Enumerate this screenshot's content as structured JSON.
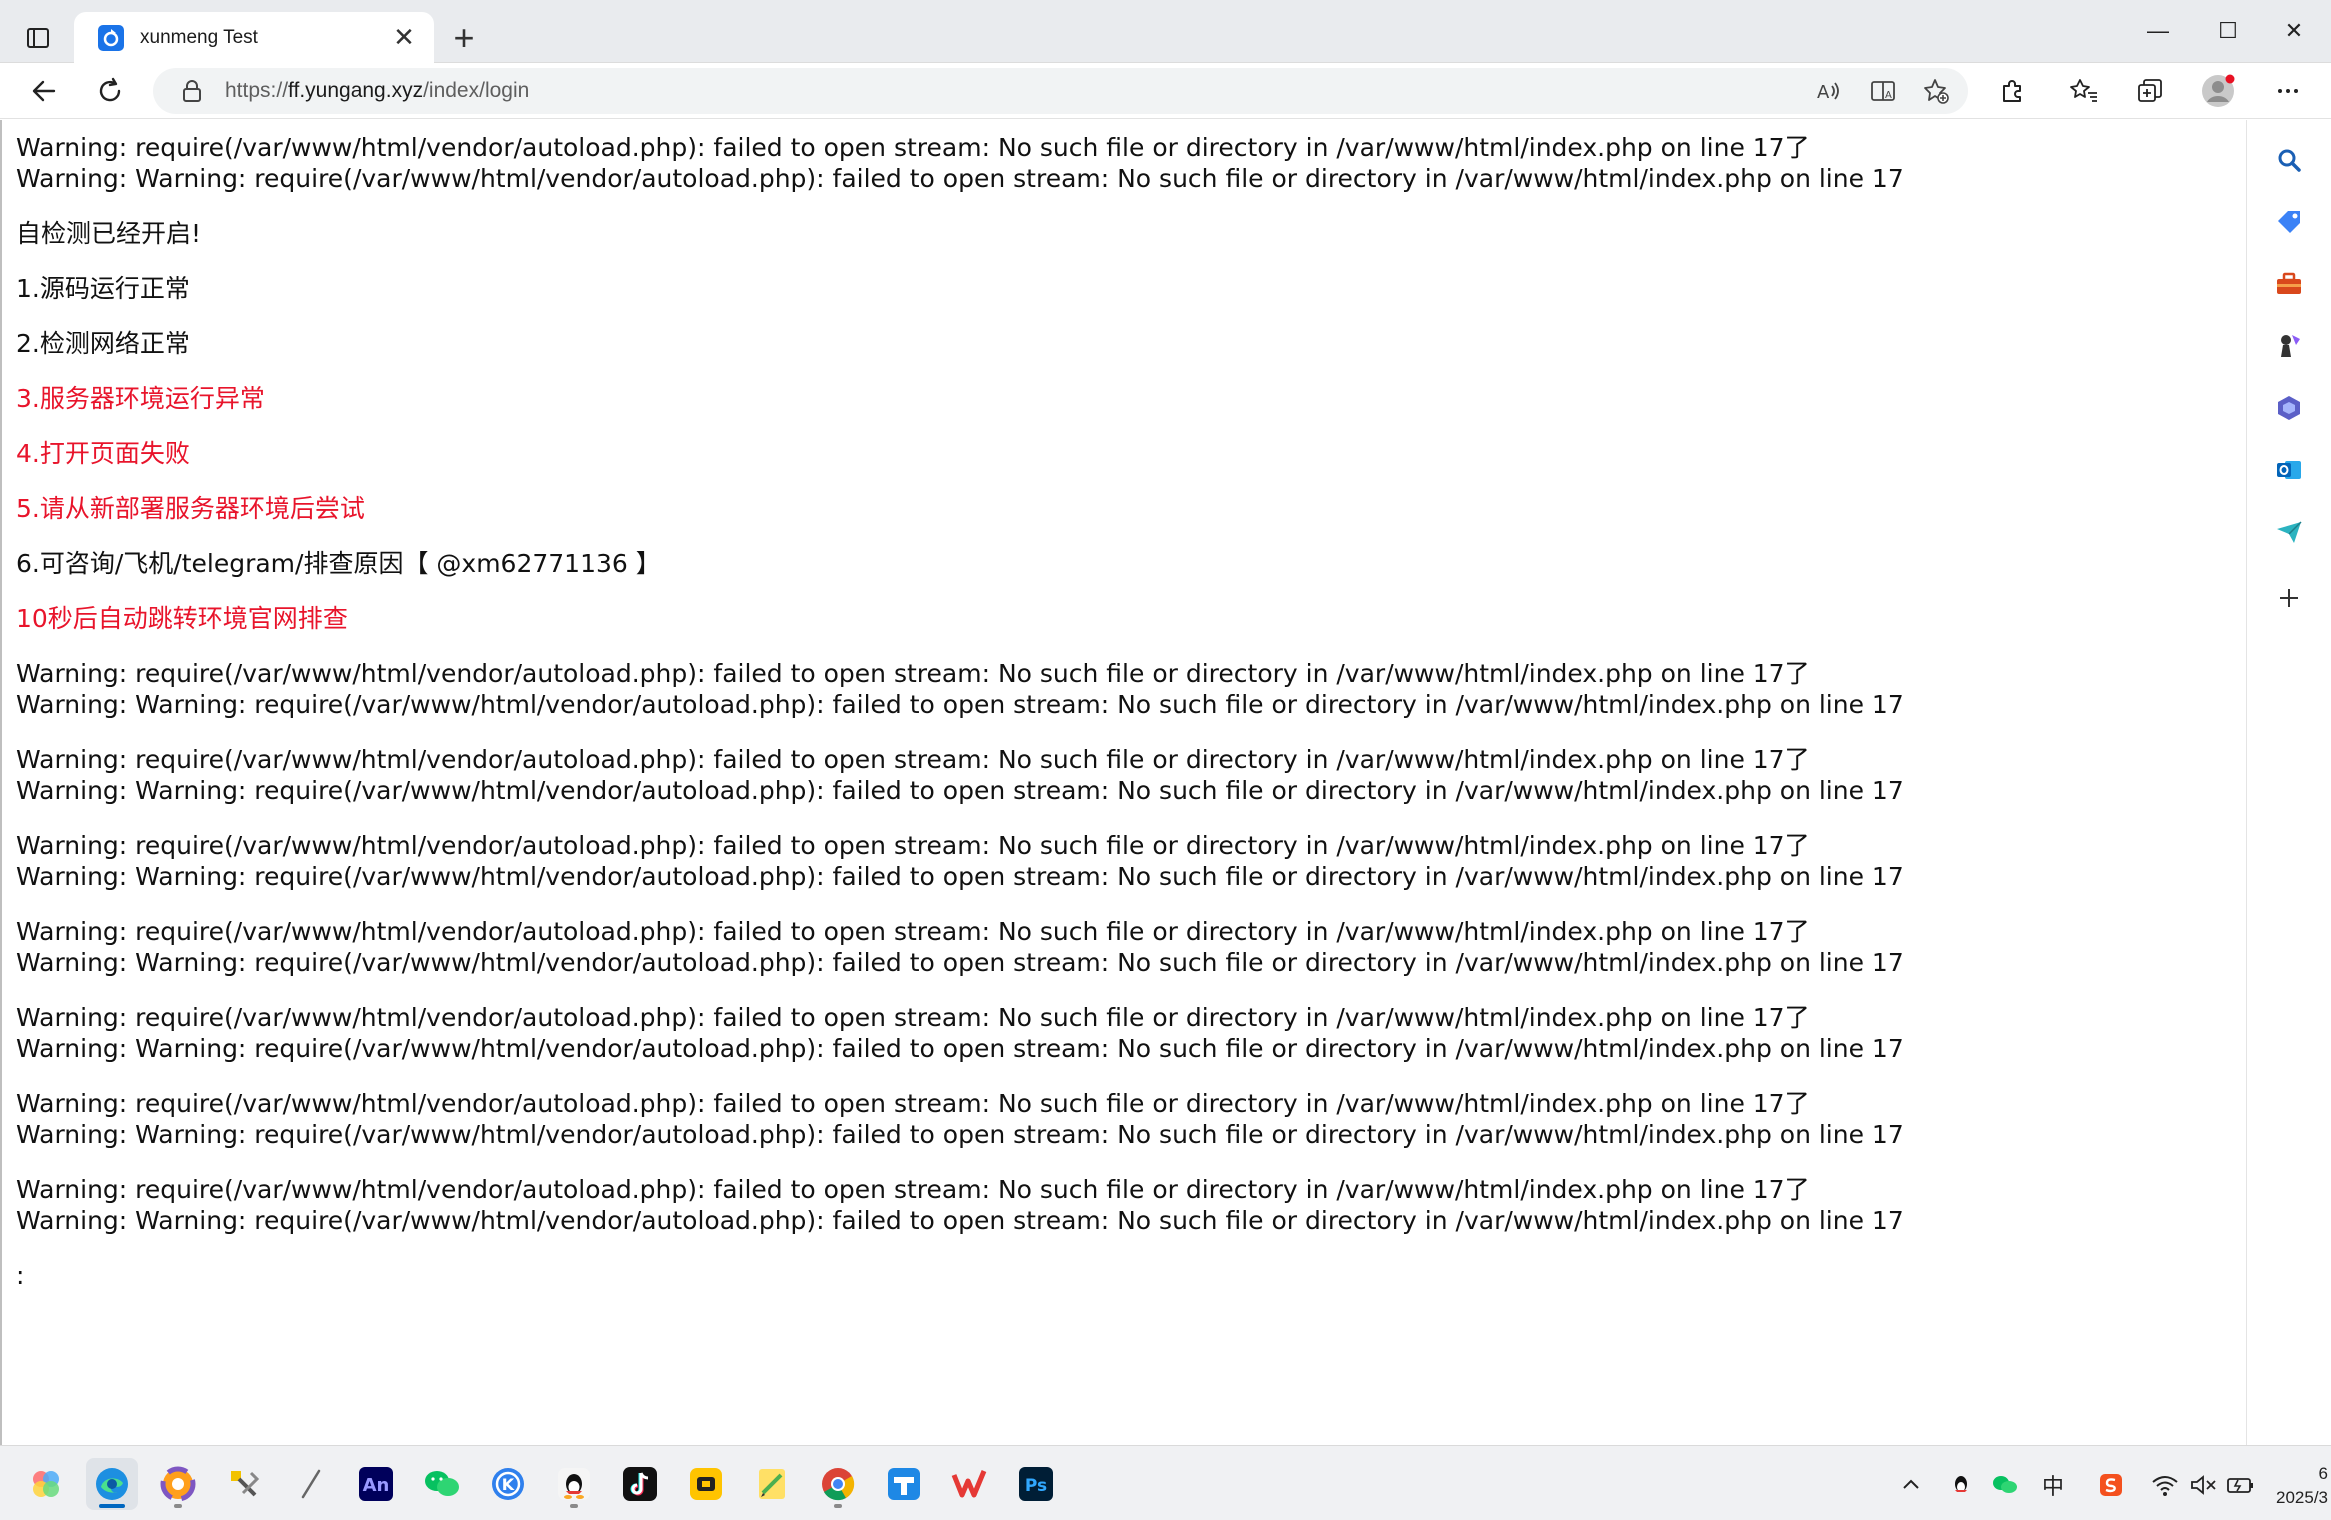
{
  "browser": {
    "tab": {
      "title": "xunmeng Test",
      "close_glyph": "✕"
    },
    "new_tab_glyph": "+",
    "window": {
      "minimize": "—",
      "maximize": "☐",
      "close": "✕"
    },
    "address": {
      "scheme_prefix": "https://",
      "host": "ff.yungang.xyz",
      "path": "/index/login"
    }
  },
  "page": {
    "warning_text": "Warning: require(/var/www/html/vendor/autoload.php): failed to open stream: No such file or directory in /var/www/html/index.php on line 17了Warning: Warning: require(/var/www/html/vendor/autoload.php): failed to open stream: No such file or directory in /var/www/html/index.php on line 17",
    "lines": [
      {
        "text": "自检测已经开启!",
        "color": "#111111"
      },
      {
        "text": "1.源码运行正常",
        "color": "#111111"
      },
      {
        "text": "2.检测网络正常",
        "color": "#111111"
      },
      {
        "text": "3.服务器环境运行异常",
        "color": "#e8142b"
      },
      {
        "text": "4.打开页面失败",
        "color": "#e8142b"
      },
      {
        "text": "5.请从新部署服务器环境后尝试",
        "color": "#e8142b"
      },
      {
        "text": "6.可咨询/飞机/telegram/排查原因【 @xm62771136 】",
        "color": "#111111"
      },
      {
        "text": "10秒后自动跳转环境官网排查",
        "color": "#e8142b"
      }
    ],
    "trailing": ":"
  },
  "sidebar_icons": [
    "search-icon",
    "tag-icon",
    "toolbox-icon",
    "chess-icon",
    "copilot-icon",
    "outlook-icon",
    "send-icon",
    "add-icon"
  ],
  "taskbar": {
    "apps": [
      "start-icon",
      "edge-icon",
      "browser360-icon",
      "tools-icon",
      "pen-icon",
      "animate-icon",
      "wechat-icon",
      "kuaiche-icon",
      "qq-icon",
      "tiktok-icon",
      "yellow-app-icon",
      "notes-icon",
      "chrome-icon",
      "blue-app-icon",
      "wps-icon",
      "photoshop-icon"
    ],
    "animate_label": "An",
    "photoshop_label": "Ps",
    "ime": "中",
    "clock_time": "6",
    "clock_date": "2025/3"
  },
  "colors": {
    "accent": "#0067c0",
    "error_red": "#e8142b"
  }
}
